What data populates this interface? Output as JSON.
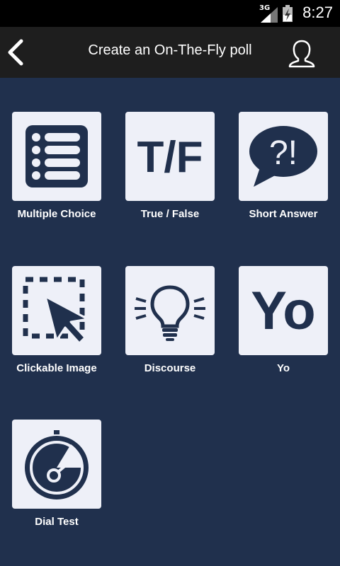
{
  "status_bar": {
    "network": "3G",
    "time": "8:27"
  },
  "app_bar": {
    "title": "Create an On-The-Fly poll"
  },
  "tiles": [
    {
      "label": "Multiple Choice"
    },
    {
      "label": "True / False",
      "glyph": "T/F"
    },
    {
      "label": "Short Answer",
      "glyph": "?!"
    },
    {
      "label": "Clickable Image"
    },
    {
      "label": "Discourse"
    },
    {
      "label": "Yo",
      "glyph": "Yo"
    },
    {
      "label": "Dial Test"
    }
  ],
  "colors": {
    "background": "#20304d",
    "card": "#eef0f8",
    "app_bar": "#1e1e1e",
    "icon": "#20304d"
  }
}
